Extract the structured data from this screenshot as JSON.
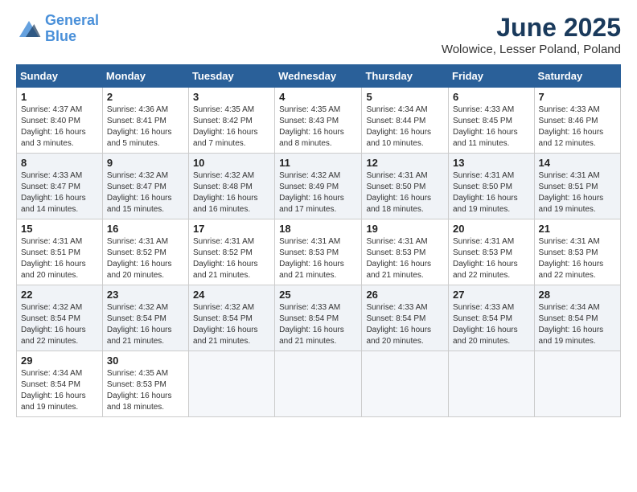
{
  "header": {
    "logo_line1": "General",
    "logo_line2": "Blue",
    "month": "June 2025",
    "location": "Wolowice, Lesser Poland, Poland"
  },
  "days_of_week": [
    "Sunday",
    "Monday",
    "Tuesday",
    "Wednesday",
    "Thursday",
    "Friday",
    "Saturday"
  ],
  "weeks": [
    [
      {
        "day": "1",
        "sunrise": "Sunrise: 4:37 AM",
        "sunset": "Sunset: 8:40 PM",
        "daylight": "Daylight: 16 hours and 3 minutes."
      },
      {
        "day": "2",
        "sunrise": "Sunrise: 4:36 AM",
        "sunset": "Sunset: 8:41 PM",
        "daylight": "Daylight: 16 hours and 5 minutes."
      },
      {
        "day": "3",
        "sunrise": "Sunrise: 4:35 AM",
        "sunset": "Sunset: 8:42 PM",
        "daylight": "Daylight: 16 hours and 7 minutes."
      },
      {
        "day": "4",
        "sunrise": "Sunrise: 4:35 AM",
        "sunset": "Sunset: 8:43 PM",
        "daylight": "Daylight: 16 hours and 8 minutes."
      },
      {
        "day": "5",
        "sunrise": "Sunrise: 4:34 AM",
        "sunset": "Sunset: 8:44 PM",
        "daylight": "Daylight: 16 hours and 10 minutes."
      },
      {
        "day": "6",
        "sunrise": "Sunrise: 4:33 AM",
        "sunset": "Sunset: 8:45 PM",
        "daylight": "Daylight: 16 hours and 11 minutes."
      },
      {
        "day": "7",
        "sunrise": "Sunrise: 4:33 AM",
        "sunset": "Sunset: 8:46 PM",
        "daylight": "Daylight: 16 hours and 12 minutes."
      }
    ],
    [
      {
        "day": "8",
        "sunrise": "Sunrise: 4:33 AM",
        "sunset": "Sunset: 8:47 PM",
        "daylight": "Daylight: 16 hours and 14 minutes."
      },
      {
        "day": "9",
        "sunrise": "Sunrise: 4:32 AM",
        "sunset": "Sunset: 8:47 PM",
        "daylight": "Daylight: 16 hours and 15 minutes."
      },
      {
        "day": "10",
        "sunrise": "Sunrise: 4:32 AM",
        "sunset": "Sunset: 8:48 PM",
        "daylight": "Daylight: 16 hours and 16 minutes."
      },
      {
        "day": "11",
        "sunrise": "Sunrise: 4:32 AM",
        "sunset": "Sunset: 8:49 PM",
        "daylight": "Daylight: 16 hours and 17 minutes."
      },
      {
        "day": "12",
        "sunrise": "Sunrise: 4:31 AM",
        "sunset": "Sunset: 8:50 PM",
        "daylight": "Daylight: 16 hours and 18 minutes."
      },
      {
        "day": "13",
        "sunrise": "Sunrise: 4:31 AM",
        "sunset": "Sunset: 8:50 PM",
        "daylight": "Daylight: 16 hours and 19 minutes."
      },
      {
        "day": "14",
        "sunrise": "Sunrise: 4:31 AM",
        "sunset": "Sunset: 8:51 PM",
        "daylight": "Daylight: 16 hours and 19 minutes."
      }
    ],
    [
      {
        "day": "15",
        "sunrise": "Sunrise: 4:31 AM",
        "sunset": "Sunset: 8:51 PM",
        "daylight": "Daylight: 16 hours and 20 minutes."
      },
      {
        "day": "16",
        "sunrise": "Sunrise: 4:31 AM",
        "sunset": "Sunset: 8:52 PM",
        "daylight": "Daylight: 16 hours and 20 minutes."
      },
      {
        "day": "17",
        "sunrise": "Sunrise: 4:31 AM",
        "sunset": "Sunset: 8:52 PM",
        "daylight": "Daylight: 16 hours and 21 minutes."
      },
      {
        "day": "18",
        "sunrise": "Sunrise: 4:31 AM",
        "sunset": "Sunset: 8:53 PM",
        "daylight": "Daylight: 16 hours and 21 minutes."
      },
      {
        "day": "19",
        "sunrise": "Sunrise: 4:31 AM",
        "sunset": "Sunset: 8:53 PM",
        "daylight": "Daylight: 16 hours and 21 minutes."
      },
      {
        "day": "20",
        "sunrise": "Sunrise: 4:31 AM",
        "sunset": "Sunset: 8:53 PM",
        "daylight": "Daylight: 16 hours and 22 minutes."
      },
      {
        "day": "21",
        "sunrise": "Sunrise: 4:31 AM",
        "sunset": "Sunset: 8:53 PM",
        "daylight": "Daylight: 16 hours and 22 minutes."
      }
    ],
    [
      {
        "day": "22",
        "sunrise": "Sunrise: 4:32 AM",
        "sunset": "Sunset: 8:54 PM",
        "daylight": "Daylight: 16 hours and 22 minutes."
      },
      {
        "day": "23",
        "sunrise": "Sunrise: 4:32 AM",
        "sunset": "Sunset: 8:54 PM",
        "daylight": "Daylight: 16 hours and 21 minutes."
      },
      {
        "day": "24",
        "sunrise": "Sunrise: 4:32 AM",
        "sunset": "Sunset: 8:54 PM",
        "daylight": "Daylight: 16 hours and 21 minutes."
      },
      {
        "day": "25",
        "sunrise": "Sunrise: 4:33 AM",
        "sunset": "Sunset: 8:54 PM",
        "daylight": "Daylight: 16 hours and 21 minutes."
      },
      {
        "day": "26",
        "sunrise": "Sunrise: 4:33 AM",
        "sunset": "Sunset: 8:54 PM",
        "daylight": "Daylight: 16 hours and 20 minutes."
      },
      {
        "day": "27",
        "sunrise": "Sunrise: 4:33 AM",
        "sunset": "Sunset: 8:54 PM",
        "daylight": "Daylight: 16 hours and 20 minutes."
      },
      {
        "day": "28",
        "sunrise": "Sunrise: 4:34 AM",
        "sunset": "Sunset: 8:54 PM",
        "daylight": "Daylight: 16 hours and 19 minutes."
      }
    ],
    [
      {
        "day": "29",
        "sunrise": "Sunrise: 4:34 AM",
        "sunset": "Sunset: 8:54 PM",
        "daylight": "Daylight: 16 hours and 19 minutes."
      },
      {
        "day": "30",
        "sunrise": "Sunrise: 4:35 AM",
        "sunset": "Sunset: 8:53 PM",
        "daylight": "Daylight: 16 hours and 18 minutes."
      },
      null,
      null,
      null,
      null,
      null
    ]
  ]
}
